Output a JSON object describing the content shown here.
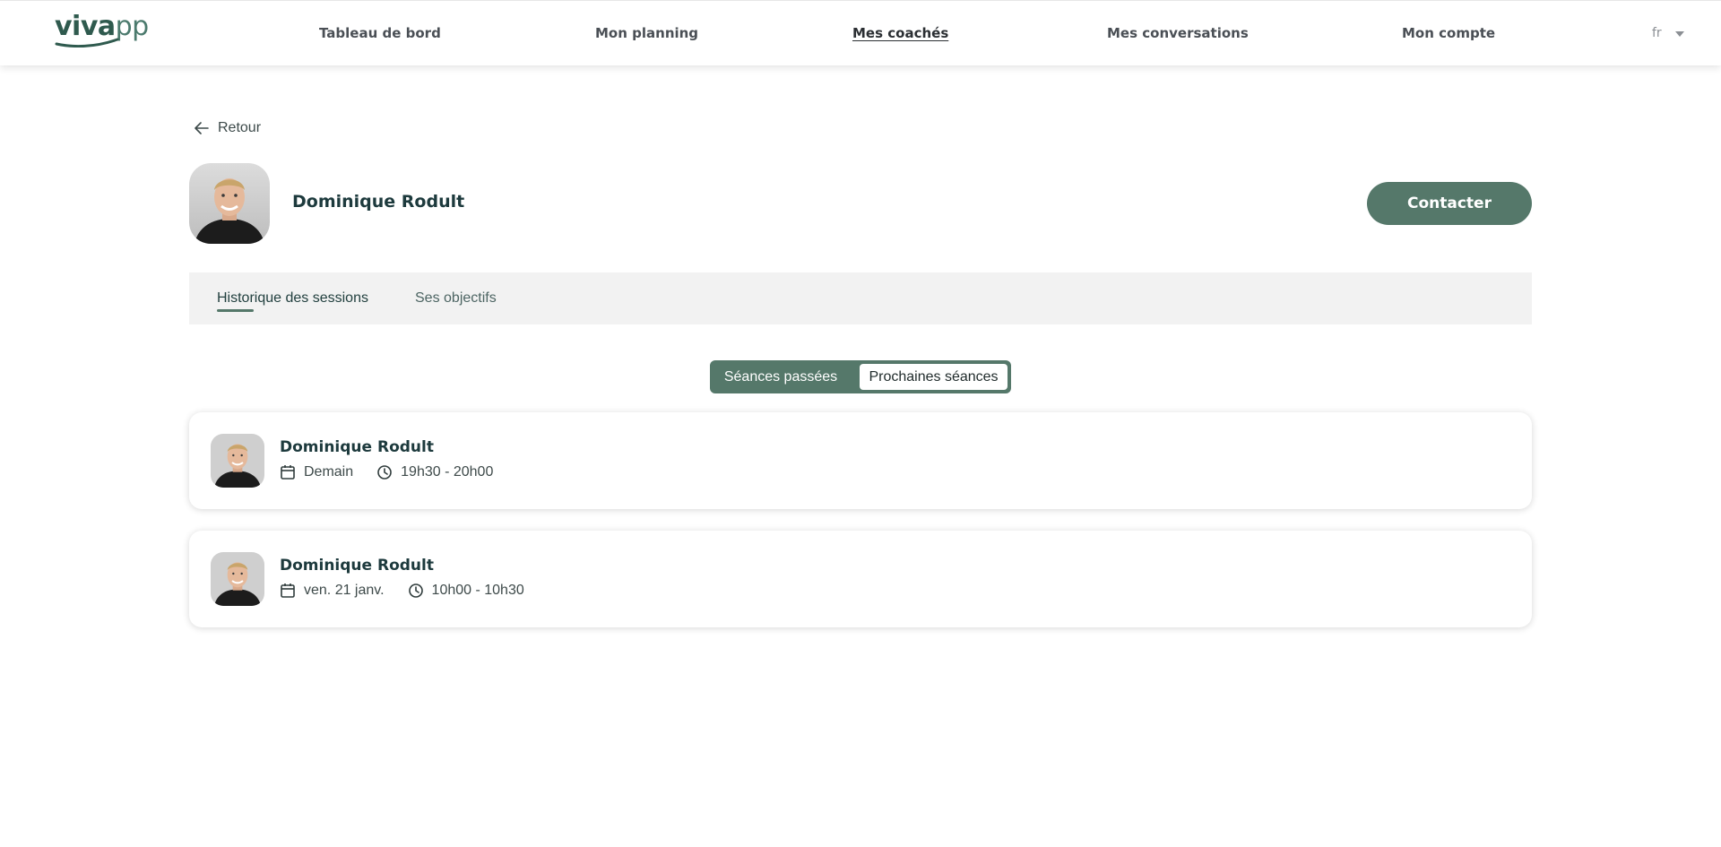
{
  "app": {
    "logo": {
      "bold": "viva",
      "light": "pp"
    },
    "nav": [
      {
        "label": "Tableau de bord"
      },
      {
        "label": "Mon planning"
      },
      {
        "label": "Mes coachés"
      },
      {
        "label": "Mes conversations"
      },
      {
        "label": "Mon compte"
      }
    ],
    "active_nav": "Mes coachés",
    "language": "fr"
  },
  "back": {
    "label": "Retour"
  },
  "profile": {
    "name": "Dominique Rodult",
    "contact_label": "Contacter"
  },
  "tabs": [
    {
      "label": "Historique des sessions",
      "active": true
    },
    {
      "label": "Ses objectifs",
      "active": false
    }
  ],
  "segmented": {
    "options": [
      "Séances passées",
      "Prochaines séances"
    ],
    "selected": "Prochaines séances"
  },
  "sessions": [
    {
      "name": "Dominique Rodult",
      "date": "Demain",
      "time": "19h30 - 20h00"
    },
    {
      "name": "Dominique Rodult",
      "date": "ven. 21 janv.",
      "time": "10h00 - 10h30"
    }
  ],
  "colors": {
    "brand": "#55786a",
    "heading": "#1d3a3d",
    "band": "#f2f2f2"
  }
}
